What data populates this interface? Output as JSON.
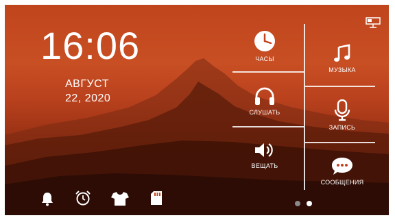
{
  "time": "16:06",
  "date": {
    "month": "АВГУСТ",
    "day": "22, 2020"
  },
  "menu": {
    "clock": "ЧАСЫ",
    "music": "МУЗЫКА",
    "listen": "СЛУШАТЬ",
    "record": "ЗАПИСЬ",
    "broadcast": "ВЕЩАТЬ",
    "messages": "СООБЩЕНИЯ"
  },
  "bottom_icons": [
    "bell-icon",
    "alarm-clock-icon",
    "shirt-icon",
    "sd-card-icon"
  ],
  "pagination": {
    "pages": 2,
    "active": 2
  },
  "colors": {
    "accent": "#ffffff",
    "background": "#c0451d",
    "dot_inactive": "#8a8a8a"
  }
}
